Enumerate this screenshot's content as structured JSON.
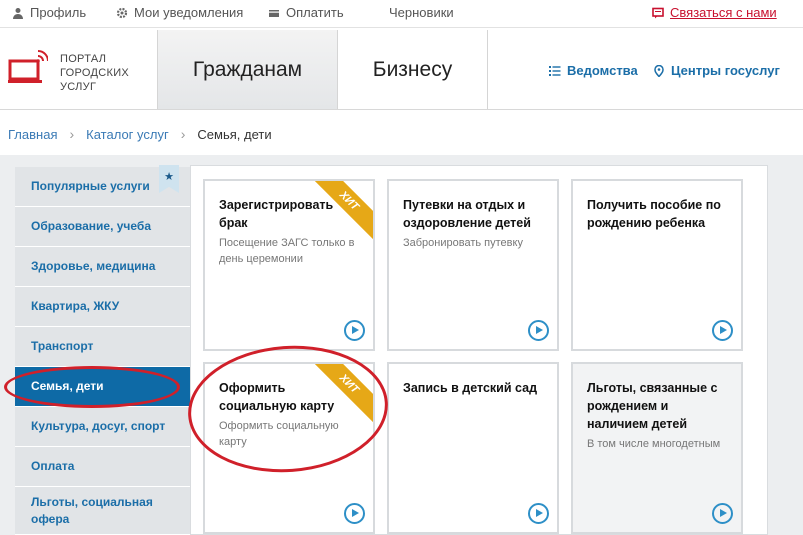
{
  "topbar": {
    "profile": "Профиль",
    "notifications": "Мои уведомления",
    "pay": "Оплатить",
    "drafts": "Черновики",
    "contact": "Связаться с нами"
  },
  "header": {
    "logo_text": "ПОРТАЛ ГОРОДСКИХ УСЛУГ",
    "tabs": [
      "Гражданам",
      "Бизнесу"
    ],
    "links": [
      "Ведомства",
      "Центры госуслуг"
    ]
  },
  "breadcrumb": {
    "home": "Главная",
    "catalog": "Каталог услуг",
    "current": "Семья, дети"
  },
  "sidebar": {
    "items": [
      "Популярные услуги",
      "Образование, учеба",
      "Здоровье, медицина",
      "Квартира, ЖКУ",
      "Транспорт",
      "Семья, дети",
      "Культура, досуг, спорт",
      "Оплата",
      "Льготы, социальная офера"
    ],
    "active_index": 5,
    "bookmark_glyph": "★"
  },
  "cards": [
    {
      "title": "Зарегистрировать брак",
      "desc": "Посещение ЗАГС только в день церемонии",
      "badge": "ХИТ"
    },
    {
      "title": "Путевки на отдых и оздоровление детей",
      "desc": "Забронировать путевку",
      "badge": ""
    },
    {
      "title": "Получить пособие по рождению ребенка",
      "desc": "",
      "badge": ""
    },
    {
      "title": "Оформить социальную карту",
      "desc": "Оформить социальную карту",
      "badge": "ХИТ"
    },
    {
      "title": "Запись в детский сад",
      "desc": "",
      "badge": ""
    },
    {
      "title": "Льготы, связанные с рождением и наличием детей",
      "desc": "В том числе многодетным",
      "badge": ""
    }
  ],
  "colors": {
    "accent_blue": "#1b6ea8",
    "active_bg": "#0e6aa6",
    "badge": "#e6a817",
    "annotation_red": "#d0202a",
    "contact_red": "#c8102e"
  }
}
